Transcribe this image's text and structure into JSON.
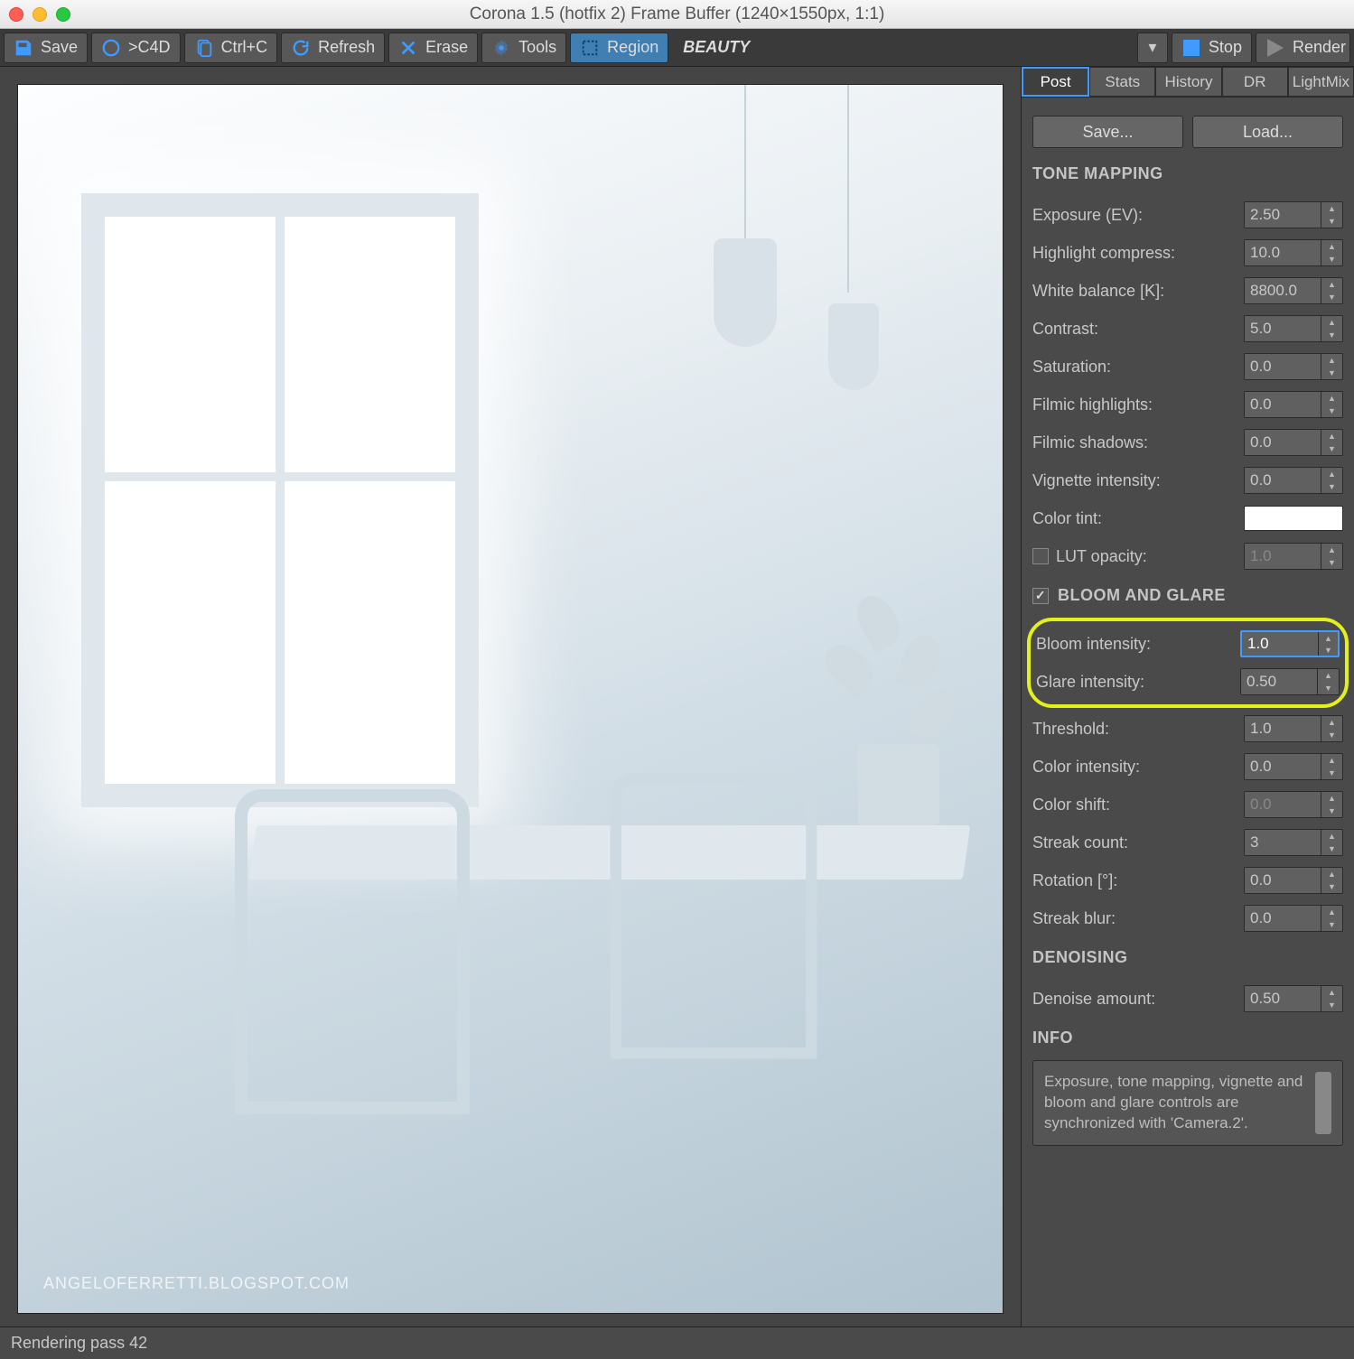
{
  "window": {
    "title": "Corona 1.5 (hotfix 2) Frame Buffer (1240×1550px, 1:1)"
  },
  "toolbar": {
    "save": "Save",
    "c4d": ">C4D",
    "copy": "Ctrl+C",
    "refresh": "Refresh",
    "erase": "Erase",
    "tools": "Tools",
    "region": "Region",
    "pass": "BEAUTY",
    "stop": "Stop",
    "render": "Render"
  },
  "viewport": {
    "watermark": "ANGELOFERRETTI.BLOGSPOT.COM"
  },
  "tabs": [
    "Post",
    "Stats",
    "History",
    "DR",
    "LightMix"
  ],
  "post": {
    "save": "Save...",
    "load": "Load...",
    "tone_mapping_header": "TONE MAPPING",
    "tone": {
      "exposure_label": "Exposure (EV):",
      "exposure": "2.50",
      "highlight_label": "Highlight compress:",
      "highlight": "10.0",
      "wb_label": "White balance [K]:",
      "wb": "8800.0",
      "contrast_label": "Contrast:",
      "contrast": "5.0",
      "saturation_label": "Saturation:",
      "saturation": "0.0",
      "filmic_hi_label": "Filmic highlights:",
      "filmic_hi": "0.0",
      "filmic_sh_label": "Filmic shadows:",
      "filmic_sh": "0.0",
      "vignette_label": "Vignette intensity:",
      "vignette": "0.0",
      "tint_label": "Color tint:",
      "lut_label": "LUT opacity:",
      "lut": "1.0"
    },
    "bloom_header": "BLOOM AND GLARE",
    "bloom": {
      "bloom_label": "Bloom intensity:",
      "bloom": "1.0",
      "glare_label": "Glare intensity:",
      "glare": "0.50",
      "threshold_label": "Threshold:",
      "threshold": "1.0",
      "color_int_label": "Color intensity:",
      "color_int": "0.0",
      "color_shift_label": "Color shift:",
      "color_shift": "0.0",
      "streak_label": "Streak count:",
      "streak": "3",
      "rotation_label": "Rotation [°]:",
      "rotation": "0.0",
      "blur_label": "Streak blur:",
      "blur": "0.0"
    },
    "denoise_header": "DENOISING",
    "denoise": {
      "amount_label": "Denoise amount:",
      "amount": "0.50"
    },
    "info_header": "INFO",
    "info_text": "Exposure, tone mapping, vignette and bloom and glare controls are synchronized with 'Camera.2'."
  },
  "status": "Rendering pass 42"
}
